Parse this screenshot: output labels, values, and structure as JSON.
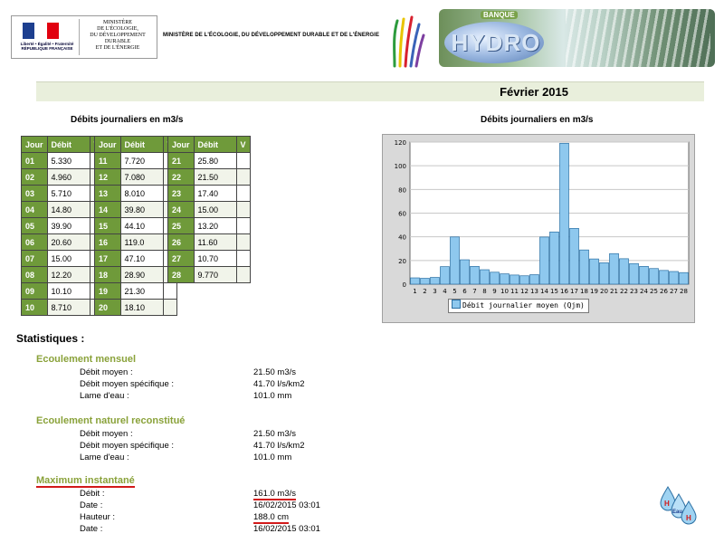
{
  "header": {
    "logo": {
      "small_text": [
        "Liberté • Égalité • Fraternité",
        "RÉPUBLIQUE FRANÇAISE"
      ],
      "ministry_lines": [
        "MINISTÈRE",
        "DE L'ÉCOLOGIE,",
        "DU DÉVELOPPEMENT",
        "DURABLE",
        "ET DE L'ÉNERGIE"
      ]
    },
    "ministry_title": "MINISTÈRE DE L'ÉCOLOGIE, DU DÉVELOPPEMENT DURABLE ET DE L'ÉNERGIE",
    "banner": {
      "banque": "BANQUE",
      "hydro": "HYDRO"
    }
  },
  "title": "Février 2015",
  "table_title": "Débits journaliers en m3/s",
  "table_headers": {
    "day": "Jour",
    "flow": "Débit",
    "validity": "V"
  },
  "daily_rows": [
    {
      "day": "01",
      "flow": "5.330"
    },
    {
      "day": "02",
      "flow": "4.960"
    },
    {
      "day": "03",
      "flow": "5.710"
    },
    {
      "day": "04",
      "flow": "14.80"
    },
    {
      "day": "05",
      "flow": "39.90"
    },
    {
      "day": "06",
      "flow": "20.60"
    },
    {
      "day": "07",
      "flow": "15.00"
    },
    {
      "day": "08",
      "flow": "12.20"
    },
    {
      "day": "09",
      "flow": "10.10"
    },
    {
      "day": "10",
      "flow": "8.710"
    },
    {
      "day": "11",
      "flow": "7.720"
    },
    {
      "day": "12",
      "flow": "7.080"
    },
    {
      "day": "13",
      "flow": "8.010"
    },
    {
      "day": "14",
      "flow": "39.80"
    },
    {
      "day": "15",
      "flow": "44.10"
    },
    {
      "day": "16",
      "flow": "119.0"
    },
    {
      "day": "17",
      "flow": "47.10"
    },
    {
      "day": "18",
      "flow": "28.90"
    },
    {
      "day": "19",
      "flow": "21.30"
    },
    {
      "day": "20",
      "flow": "18.10"
    },
    {
      "day": "21",
      "flow": "25.80"
    },
    {
      "day": "22",
      "flow": "21.50"
    },
    {
      "day": "23",
      "flow": "17.40"
    },
    {
      "day": "24",
      "flow": "15.00"
    },
    {
      "day": "25",
      "flow": "13.20"
    },
    {
      "day": "26",
      "flow": "11.60"
    },
    {
      "day": "27",
      "flow": "10.70"
    },
    {
      "day": "28",
      "flow": "9.770"
    }
  ],
  "chart_title": "Débits journaliers en m3/s",
  "chart_data": {
    "type": "bar",
    "categories": [
      "1",
      "2",
      "3",
      "4",
      "5",
      "6",
      "7",
      "8",
      "9",
      "10",
      "11",
      "12",
      "13",
      "14",
      "15",
      "16",
      "17",
      "18",
      "19",
      "20",
      "21",
      "22",
      "23",
      "24",
      "25",
      "26",
      "27",
      "28"
    ],
    "series": [
      {
        "name": "Débit journalier moyen (Qjm)",
        "values": [
          5.33,
          4.96,
          5.71,
          14.8,
          39.9,
          20.6,
          15.0,
          12.2,
          10.1,
          8.71,
          7.72,
          7.08,
          8.01,
          39.8,
          44.1,
          119.0,
          47.1,
          28.9,
          21.3,
          18.1,
          25.8,
          21.5,
          17.4,
          15.0,
          13.2,
          11.6,
          10.7,
          9.77
        ]
      }
    ],
    "y_ticks": [
      "0",
      "20",
      "40",
      "60",
      "80",
      "100",
      "120"
    ],
    "ylim": [
      0,
      120
    ],
    "grid": true,
    "legend": "bottom",
    "bar_color": "#8ec8ee",
    "bar_edge": "#2b6fa3"
  },
  "statistics": {
    "title": "Statistiques :",
    "monthly": {
      "title": "Ecoulement mensuel",
      "items": [
        {
          "label": "Débit moyen :",
          "value": "21.50 m3/s"
        },
        {
          "label": "Débit moyen spécifique :",
          "value": "41.70 l/s/km2"
        },
        {
          "label": "Lame d'eau :",
          "value": "101.0 mm"
        }
      ]
    },
    "natural": {
      "title": "Ecoulement naturel reconstitué",
      "items": [
        {
          "label": "Débit moyen :",
          "value": "21.50 m3/s"
        },
        {
          "label": "Débit moyen spécifique :",
          "value": "41.70 l/s/km2"
        },
        {
          "label": "Lame d'eau :",
          "value": "101.0 mm"
        }
      ]
    },
    "maximum": {
      "title": "Maximum instantané",
      "items": [
        {
          "label": "Débit :",
          "value": "161.0 m3/s"
        },
        {
          "label": "Date :",
          "value": "16/02/2015 03:01"
        },
        {
          "label": "Hauteur :",
          "value": "188.0 cm"
        },
        {
          "label": "Date :",
          "value": "16/02/2015 03:01"
        }
      ]
    }
  },
  "footer_logo": {
    "letters": [
      "H",
      "Eau",
      "H"
    ]
  },
  "colors": {
    "accent_green": "#6f9a3a",
    "title_bar": "#e9efdc",
    "subtitle_green": "#8aa23a",
    "underline_red": "#d21a1a"
  }
}
